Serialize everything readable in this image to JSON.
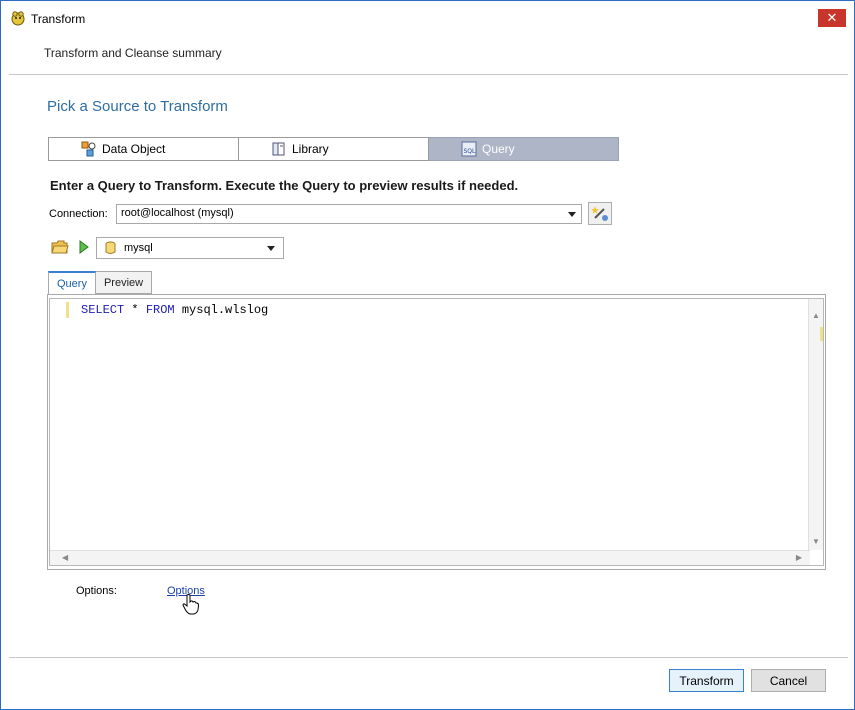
{
  "window": {
    "title": "Transform",
    "close_label": "✕"
  },
  "header": {
    "summary": "Transform and Cleanse summary"
  },
  "main": {
    "heading": "Pick a Source to Transform",
    "source_tabs": [
      {
        "label": "Data Object",
        "icon": "data-object-icon"
      },
      {
        "label": "Library",
        "icon": "library-icon"
      },
      {
        "label": "Query",
        "icon": "sql-icon"
      }
    ],
    "instruction": "Enter a Query to Transform.  Execute the Query to preview results if needed.",
    "connection": {
      "label": "Connection:",
      "value": "root@localhost (mysql)"
    },
    "database": {
      "value": "mysql"
    },
    "editor_tabs": [
      {
        "label": "Query"
      },
      {
        "label": "Preview"
      }
    ],
    "query": {
      "kw1": "SELECT",
      "star": " * ",
      "kw2": "FROM",
      "rest": " mysql.wlslog"
    },
    "options": {
      "label": "Options:",
      "link": "Options"
    }
  },
  "footer": {
    "transform_label": "Transform",
    "cancel_label": "Cancel"
  },
  "colors": {
    "heading": "#2f6ea3",
    "active_tab": "#adb5c6",
    "close": "#c8352a",
    "keyword": "#1d1db5"
  }
}
